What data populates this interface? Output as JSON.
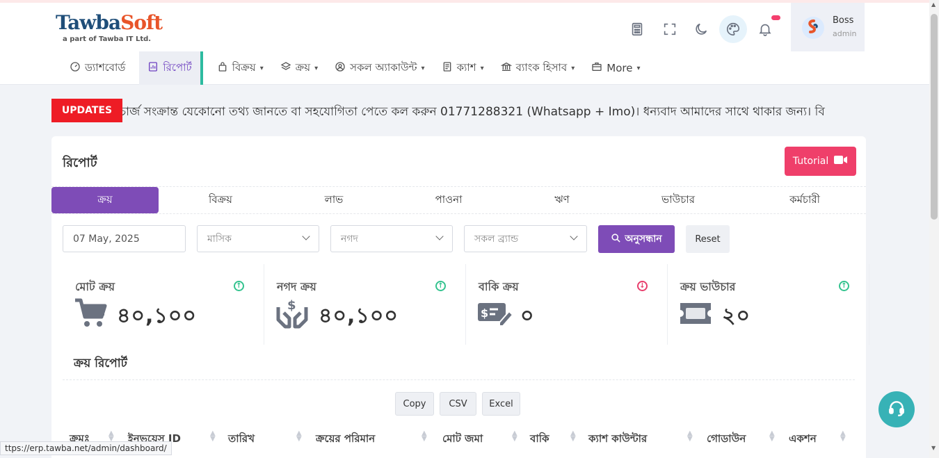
{
  "logo": {
    "brand_main": "Tawba",
    "brand_accent": "Soft",
    "tagline": "a part of Tawba IT Ltd."
  },
  "header_icons": [
    "calculator-icon",
    "fullscreen-icon",
    "moon-icon",
    "palette-icon",
    "bell-icon"
  ],
  "user": {
    "name": "Boss",
    "role": "admin"
  },
  "nav": [
    {
      "label": "ড্যাশবোর্ড",
      "icon": "dashboard-icon",
      "dropdown": false
    },
    {
      "label": "রিপোর্ট",
      "icon": "report-icon",
      "dropdown": false,
      "active": true
    },
    {
      "label": "বিক্রয়",
      "icon": "bag-icon",
      "dropdown": true
    },
    {
      "label": "ক্রয়",
      "icon": "layers-icon",
      "dropdown": true
    },
    {
      "label": "সকল অ্যাকাউন্ট",
      "icon": "user-circle-icon",
      "dropdown": true
    },
    {
      "label": "ক্যাশ",
      "icon": "receipt-icon",
      "dropdown": true
    },
    {
      "label": "ব্যাংক হিসাব",
      "icon": "bank-icon",
      "dropdown": true
    },
    {
      "label": "More",
      "icon": "briefcase-icon",
      "dropdown": true
    }
  ],
  "ticker": {
    "badge": "UPDATES",
    "text": "চার্জ সংক্রান্ত যেকোনো তথ্য জানতে বা সহযোগিতা পেতে কল করুন 01771288321 (Whatsapp + Imo)। ধন্যবাদ আমাদের সাথে থাকার জন্য। বি"
  },
  "card": {
    "title": "রিপোর্ট",
    "tutorial_label": "Tutorial",
    "tabs": [
      "ক্রয়",
      "বিক্রয়",
      "লাভ",
      "পাওনা",
      "ঋণ",
      "ভাউচার",
      "কর্মচারী"
    ],
    "filters": {
      "date": "07 May, 2025",
      "period": "মাসিক",
      "payment": "নগদ",
      "brand": "সকল ব্র্যান্ড",
      "search_label": "অনুসন্ধান",
      "reset_label": "Reset"
    },
    "stats": [
      {
        "label": "মোট ক্রয়",
        "value": "৪০,১০০",
        "trend": "up",
        "icon": "cart-icon"
      },
      {
        "label": "নগদ ক্রয়",
        "value": "৪০,১০০",
        "trend": "up",
        "icon": "cash-hands-icon"
      },
      {
        "label": "বাকি ক্রয়",
        "value": "০",
        "trend": "down",
        "icon": "cheque-icon"
      },
      {
        "label": "ক্রয় ভাউচার",
        "value": "২০",
        "trend": "up",
        "icon": "ticket-icon"
      }
    ],
    "report_title": "ক্রয় রিপোর্ট",
    "export_buttons": [
      "Copy",
      "CSV",
      "Excel"
    ],
    "table_headers": [
      "ক্রমঃ",
      "ইনভয়েস ID",
      "তারিখ",
      "ক্রয়ের পরিমান",
      "মোট জমা",
      "বাকি",
      "ক্যাশ কাউন্টার",
      "গোডাউন",
      "একশন"
    ]
  },
  "status_url": "ttps://erp.tawba.net/admin/dashboard/",
  "colors": {
    "primary": "#7e4cb7",
    "danger": "#ef3f6a",
    "teal": "#37b2b6",
    "update_red": "#ee1c25"
  }
}
